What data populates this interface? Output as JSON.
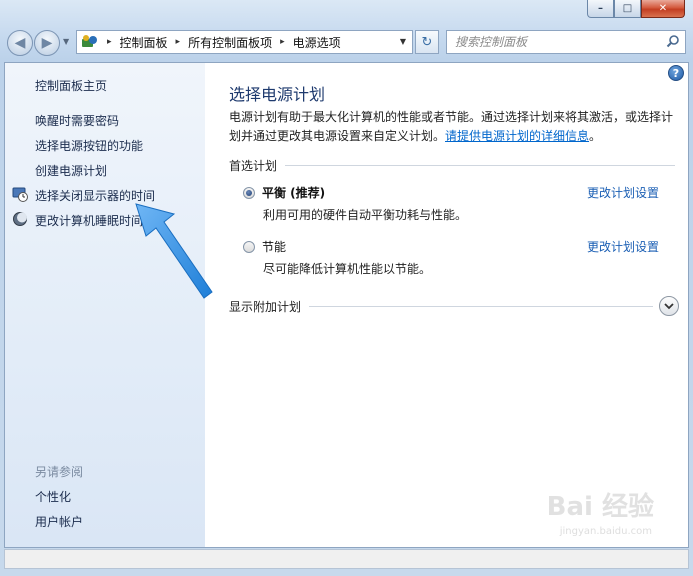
{
  "window": {
    "close_glyph": "✕",
    "max_glyph": "□",
    "min_glyph": "–"
  },
  "nav": {
    "back_glyph": "◀",
    "forward_glyph": "▶",
    "drop_glyph": "▼"
  },
  "address": {
    "crumbs": [
      "控制面板",
      "所有控制面板项",
      "电源选项"
    ],
    "sep_glyph": "▸",
    "drop_glyph": "▼",
    "refresh_glyph": "↻"
  },
  "search": {
    "placeholder": "搜索控制面板"
  },
  "sidebar": {
    "home": "控制面板主页",
    "items": [
      {
        "label": "唤醒时需要密码"
      },
      {
        "label": "选择电源按钮的功能"
      },
      {
        "label": "创建电源计划"
      },
      {
        "label": "选择关闭显示器的时间",
        "icon": "monitor-clock-icon"
      },
      {
        "label": "更改计算机睡眠时间",
        "icon": "moon-icon"
      }
    ],
    "see_also": "另请参阅",
    "see_also_items": [
      {
        "label": "个性化"
      },
      {
        "label": "用户帐户"
      }
    ]
  },
  "main": {
    "help_glyph": "?",
    "title": "选择电源计划",
    "description": "电源计划有助于最大化计算机的性能或者节能。通过选择计划来将其激活，或选择计划并通过更改其电源设置来自定义计划。",
    "more_link": "请提供电源计划的详细信息",
    "period": "。",
    "preferred_heading": "首选计划",
    "plans": [
      {
        "name": "平衡 (推荐)",
        "desc": "利用可用的硬件自动平衡功耗与性能。",
        "link": "更改计划设置",
        "selected": true
      },
      {
        "name": "节能",
        "desc": "尽可能降低计算机性能以节能。",
        "link": "更改计划设置",
        "selected": false
      }
    ],
    "additional_heading": "显示附加计划"
  },
  "watermark": {
    "brand": "Bai 经验",
    "url": "jingyan.baidu.com"
  },
  "colors": {
    "accent_link": "#1b5fb4",
    "title_blue": "#1e3a6e",
    "arrow_blue": "#2a8be0"
  }
}
